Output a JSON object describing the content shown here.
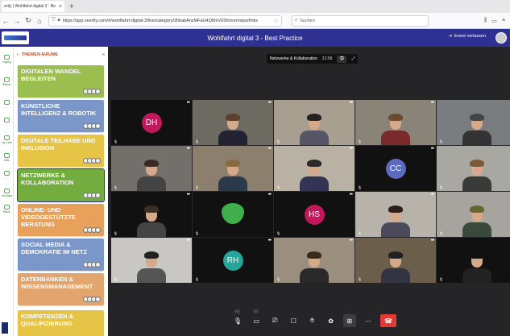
{
  "browser": {
    "tab_title": "ertly | Wohlfahrt digital 3 - Be",
    "url": "https://app.veertly.com/#/wohlfahrt-digital-3/live/category/2hkabAnzMFaU4Q8mV03I/room/sijoxfmkx",
    "search_placeholder": "Suchen"
  },
  "header": {
    "event_title": "Wohlfahrt digital 3 - Best Practice",
    "leave_label": "Event verlassen"
  },
  "icon_strip": {
    "items": [
      "ingang",
      "Räume",
      "...",
      "...",
      "ng Café",
      "Hilfe",
      "...",
      "Umfrage",
      "Raum"
    ]
  },
  "sidebar": {
    "title": "THEMEN-RÄUME",
    "rooms": [
      {
        "label": "DIGITALEN WANDEL BEGLEITEN",
        "color": "#9bbf4f"
      },
      {
        "label": "KÜNSTLICHE INTELLIGENZ & ROBOTIK",
        "color": "#7b96c8"
      },
      {
        "label": "DIGITALE TEILHABE UND INKLUSION",
        "color": "#e6c445"
      },
      {
        "label": "NETZWERKE & KOLLABORATION",
        "color": "#74ad3f"
      },
      {
        "label": "ONLINE- UND VIDEOGESTÜTZTE BERATUNG",
        "color": "#e7a15a"
      },
      {
        "label": "SOCIAL MEDIA & DEMOKRATIE IM NETZ",
        "color": "#7b96c8"
      },
      {
        "label": "DATENBANKEN & WISSENSMANAGEMENT",
        "color": "#e2a56d"
      },
      {
        "label": "KOMPETENZEN & QUALIFIZIERUNG",
        "color": "#e6c445"
      }
    ]
  },
  "stage": {
    "room_name": "Netzwerke & Kollaboration",
    "timer": "21:59"
  },
  "participants": [
    {
      "initials": "DH",
      "avatar_color": "#c2185b"
    },
    {
      "initials": ""
    },
    {
      "initials": ""
    },
    {
      "initials": ""
    },
    {
      "initials": ""
    },
    {
      "initials": ""
    },
    {
      "initials": ""
    },
    {
      "initials": ""
    },
    {
      "initials": "CC",
      "avatar_color": "#5c6bc0"
    },
    {
      "initials": ""
    },
    {
      "initials": ""
    },
    {
      "initials": ""
    },
    {
      "initials": "HS",
      "avatar_color": "#c2185b"
    },
    {
      "initials": ""
    },
    {
      "initials": ""
    },
    {
      "initials": ""
    },
    {
      "initials": "RH",
      "avatar_color": "#26a69a"
    },
    {
      "initials": ""
    },
    {
      "initials": ""
    },
    {
      "initials": ""
    }
  ],
  "colors": {
    "brand": "#2e3192",
    "hangup": "#e53935"
  }
}
